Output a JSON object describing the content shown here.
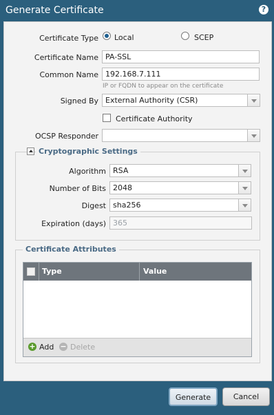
{
  "window": {
    "title": "Generate Certificate",
    "help_icon": "?"
  },
  "form": {
    "certificate_type": {
      "label": "Certificate Type",
      "options": [
        "Local",
        "SCEP"
      ],
      "selected": "Local"
    },
    "certificate_name": {
      "label": "Certificate Name",
      "value": "PA-SSL"
    },
    "common_name": {
      "label": "Common Name",
      "value": "192.168.7.111",
      "hint": "IP or FQDN to appear on the certificate"
    },
    "signed_by": {
      "label": "Signed By",
      "value": "External Authority (CSR)"
    },
    "certificate_authority": {
      "label": "Certificate Authority",
      "checked": false
    },
    "ocsp_responder": {
      "label": "OCSP Responder",
      "value": ""
    }
  },
  "crypto": {
    "legend": "Cryptographic Settings",
    "algorithm": {
      "label": "Algorithm",
      "value": "RSA"
    },
    "number_of_bits": {
      "label": "Number of Bits",
      "value": "2048"
    },
    "digest": {
      "label": "Digest",
      "value": "sha256"
    },
    "expiration": {
      "label": "Expiration (days)",
      "value": "365"
    }
  },
  "attributes": {
    "legend": "Certificate Attributes",
    "columns": [
      "Type",
      "Value"
    ],
    "rows": [],
    "add_label": "Add",
    "delete_label": "Delete"
  },
  "buttons": {
    "generate": "Generate",
    "cancel": "Cancel"
  },
  "colors": {
    "titlebar": "#2b5f7d",
    "panel": "#f3f3f3",
    "legend": "#4a6a85",
    "grid_header": "#6e757c"
  }
}
